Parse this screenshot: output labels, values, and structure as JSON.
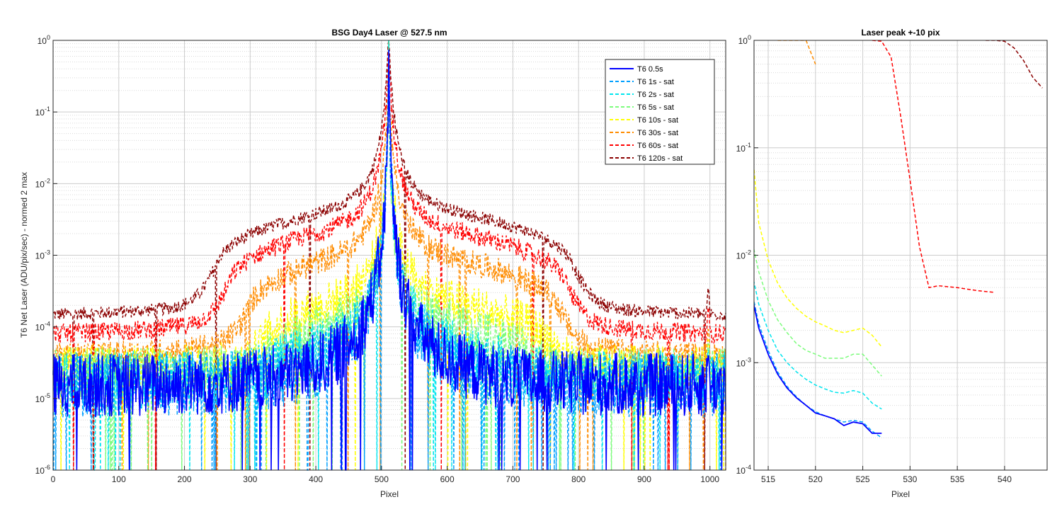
{
  "chart_data": [
    {
      "type": "line",
      "title": "BSG  Day4 Laser @ 527.5 nm",
      "xlabel": "Pixel",
      "ylabel": "T6 Net Laser (ADU/pix/sec) - normed 2 max",
      "xlim": [
        0,
        1024
      ],
      "ylim": [
        1e-06,
        1
      ],
      "yscale": "log",
      "grid": true,
      "legend_position": "top-right",
      "xticks": [
        "0",
        "100",
        "200",
        "300",
        "400",
        "500",
        "600",
        "700",
        "800",
        "900",
        "1000"
      ],
      "yticks": [
        "10^-6",
        "10^-5",
        "10^-4",
        "10^-3",
        "10^-2",
        "10^-1",
        "10^0"
      ],
      "series": [
        {
          "name": "T6 0.5s",
          "color": "#0000ff",
          "style": "solid",
          "floor": 1.5e-05,
          "shoulder": 0,
          "shoulder_x": [
            0,
            0
          ],
          "noise": 1.0,
          "peak_x": 511,
          "points": [
            [
              512,
              0.022
            ],
            [
              513,
              0.0055
            ],
            [
              514,
              0.0021
            ],
            [
              515,
              0.0012
            ],
            [
              516,
              0.00078
            ],
            [
              517,
              0.00058
            ],
            [
              518,
              0.00047
            ],
            [
              519,
              0.0004
            ],
            [
              520,
              0.00034
            ],
            [
              521,
              0.00032
            ],
            [
              522,
              0.0003
            ],
            [
              523,
              0.00026
            ],
            [
              524,
              0.00028
            ],
            [
              525,
              0.00027
            ],
            [
              526,
              0.00022
            ],
            [
              527,
              0.00022
            ]
          ]
        },
        {
          "name": "T6 1s - sat",
          "color": "#00a0ff",
          "style": "dashed",
          "floor": 1.5e-05,
          "shoulder": 0,
          "shoulder_x": [
            0,
            0
          ],
          "noise": 1.0,
          "peak_x": 511,
          "points": [
            [
              512,
              0.025
            ],
            [
              513,
              0.006
            ],
            [
              514,
              0.0023
            ],
            [
              515,
              0.0013
            ],
            [
              516,
              0.00082
            ],
            [
              517,
              0.0006
            ],
            [
              518,
              0.00048
            ],
            [
              519,
              0.0004
            ],
            [
              520,
              0.00035
            ],
            [
              521,
              0.00032
            ],
            [
              522,
              0.0003
            ],
            [
              523,
              0.00028
            ],
            [
              524,
              0.00029
            ],
            [
              525,
              0.00028
            ],
            [
              526,
              0.00023
            ],
            [
              527,
              0.0002
            ]
          ]
        },
        {
          "name": "T6 2s - sat",
          "color": "#00e5ee",
          "style": "dashed",
          "floor": 1.8e-05,
          "shoulder": 2.5e-05,
          "shoulder_x": [
            330,
            700
          ],
          "noise": 0.9,
          "peak_x": 511,
          "points": [
            [
              512,
              0.04
            ],
            [
              513,
              0.009
            ],
            [
              514,
              0.0035
            ],
            [
              515,
              0.002
            ],
            [
              516,
              0.0013
            ],
            [
              517,
              0.001
            ],
            [
              518,
              0.00082
            ],
            [
              519,
              0.0007
            ],
            [
              520,
              0.00062
            ],
            [
              521,
              0.00057
            ],
            [
              522,
              0.00053
            ],
            [
              523,
              0.00052
            ],
            [
              524,
              0.00055
            ],
            [
              525,
              0.00052
            ],
            [
              526,
              0.00042
            ],
            [
              527,
              0.00037
            ]
          ]
        },
        {
          "name": "T6 5s - sat",
          "color": "#7cfc7c",
          "style": "dashed",
          "floor": 2.2e-05,
          "shoulder": 8e-05,
          "shoulder_x": [
            330,
            740
          ],
          "noise": 0.8,
          "peak_x": 511,
          "points": [
            [
              512,
              0.1
            ],
            [
              513,
              0.018
            ],
            [
              514,
              0.007
            ],
            [
              515,
              0.0038
            ],
            [
              516,
              0.0025
            ],
            [
              517,
              0.0019
            ],
            [
              518,
              0.0015
            ],
            [
              519,
              0.0013
            ],
            [
              520,
              0.0012
            ],
            [
              521,
              0.0011
            ],
            [
              522,
              0.0011
            ],
            [
              523,
              0.0011
            ],
            [
              524,
              0.0012
            ],
            [
              525,
              0.0012
            ],
            [
              526,
              0.00095
            ],
            [
              527,
              0.00075
            ]
          ]
        },
        {
          "name": "T6 10s - sat",
          "color": "#ffff00",
          "style": "dashed",
          "floor": 2.5e-05,
          "shoulder": 0.0002,
          "shoulder_x": [
            320,
            760
          ],
          "noise": 0.7,
          "peak_x": 511,
          "points": [
            [
              512,
              1.0
            ],
            [
              513,
              0.2
            ],
            [
              514,
              0.02
            ],
            [
              515,
              0.009
            ],
            [
              516,
              0.0055
            ],
            [
              517,
              0.004
            ],
            [
              518,
              0.0032
            ],
            [
              519,
              0.0027
            ],
            [
              520,
              0.0024
            ],
            [
              521,
              0.0022
            ],
            [
              522,
              0.002
            ],
            [
              523,
              0.0019
            ],
            [
              524,
              0.002
            ],
            [
              525,
              0.0021
            ],
            [
              526,
              0.0018
            ],
            [
              527,
              0.0014
            ]
          ]
        },
        {
          "name": "T6 30s - sat",
          "color": "#ff8c00",
          "style": "dashed",
          "floor": 3.5e-05,
          "shoulder": 0.0009,
          "shoulder_x": [
            300,
            770
          ],
          "noise": 0.4,
          "peak_x": 511,
          "points": [
            [
              516,
              1.0
            ],
            [
              517,
              1.0
            ],
            [
              518,
              1.0
            ],
            [
              519,
              1.0
            ],
            [
              520,
              0.6
            ]
          ]
        },
        {
          "name": "T6 60s - sat",
          "color": "#ff0000",
          "style": "dashed",
          "floor": 7e-05,
          "shoulder": 0.0022,
          "shoulder_x": [
            270,
            780
          ],
          "noise": 0.3,
          "peak_x": 511,
          "points": [
            [
              526,
              1.0
            ],
            [
              527,
              0.98
            ],
            [
              528,
              0.7
            ],
            [
              529,
              0.2
            ],
            [
              530,
              0.05
            ],
            [
              531,
              0.012
            ],
            [
              532,
              0.005
            ],
            [
              533,
              0.0052
            ],
            [
              535,
              0.005
            ],
            [
              537,
              0.0047
            ],
            [
              539,
              0.0045
            ]
          ]
        },
        {
          "name": "T6 120s - sat",
          "color": "#8b0000",
          "style": "dashed",
          "floor": 0.00013,
          "shoulder": 0.004,
          "shoulder_x": [
            250,
            790
          ],
          "noise": 0.2,
          "peak_x": 511,
          "points": [
            [
              538,
              1.0
            ],
            [
              539,
              1.0
            ],
            [
              540,
              0.98
            ],
            [
              541,
              0.85
            ],
            [
              542,
              0.65
            ],
            [
              543,
              0.45
            ],
            [
              544,
              0.36
            ]
          ]
        }
      ]
    },
    {
      "type": "line",
      "title": "Laser peak +-10 pix",
      "xlabel": "Pixel",
      "ylabel": "",
      "xlim": [
        513.5,
        544.5
      ],
      "ylim": [
        0.0001,
        1
      ],
      "yscale": "log",
      "grid": true,
      "xticks": [
        "515",
        "520",
        "525",
        "530",
        "535",
        "540"
      ],
      "yticks": [
        "10^-4",
        "10^-3",
        "10^-2",
        "10^-1",
        "10^0"
      ]
    }
  ]
}
